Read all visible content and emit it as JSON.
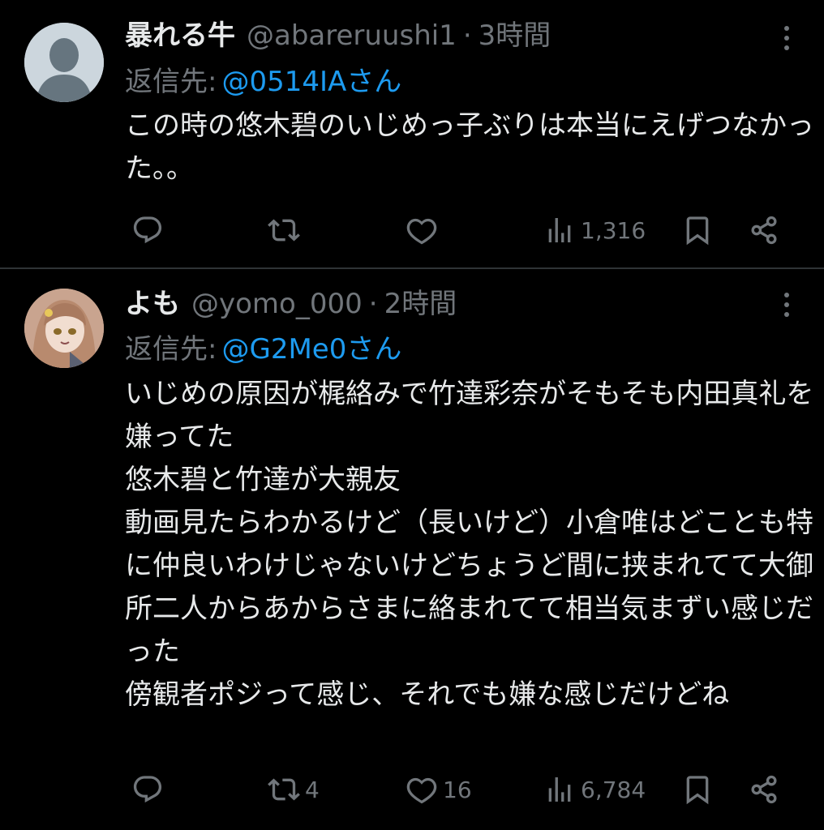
{
  "tweets": [
    {
      "display_name": "暴れる牛",
      "handle": "@abareruushi1",
      "separator": "·",
      "time": "3時間",
      "reply_prefix": "返信先:",
      "reply_to": "@0514IAさん",
      "text": "この時の悠木碧のいじめっ子ぶりは本当にえげつなかった。。",
      "replies": "",
      "retweets": "",
      "likes": "",
      "views": "1,316",
      "avatar": "default-avatar"
    },
    {
      "display_name": "よも",
      "handle": "@yomo_000",
      "separator": "·",
      "time": "2時間",
      "reply_prefix": "返信先:",
      "reply_to": "@G2Me0さん",
      "text": "いじめの原因が梶絡みで竹達彩奈がそもそも内田真礼を嫌ってた\n悠木碧と竹達が大親友\n動画見たらわかるけど（長いけど）小倉唯はどことも特に仲良いわけじゃないけどちょうど間に挟まれてて大御所二人からあからさまに絡まれてて相当気まずい感じだった\n傍観者ポジって感じ、それでも嫌な感じだけどね",
      "replies": "",
      "retweets": "4",
      "likes": "16",
      "views": "6,784",
      "avatar": "anime-girl-avatar"
    }
  ],
  "icons": {
    "reply": "reply-icon",
    "retweet": "retweet-icon",
    "like": "heart-icon",
    "views": "views-icon",
    "bookmark": "bookmark-icon",
    "share": "share-icon",
    "more": "more-vertical-icon"
  },
  "colors": {
    "background": "#000000",
    "text": "#e7e9ea",
    "muted": "#71767b",
    "link": "#1d9bf0",
    "divider": "#2f3336"
  }
}
